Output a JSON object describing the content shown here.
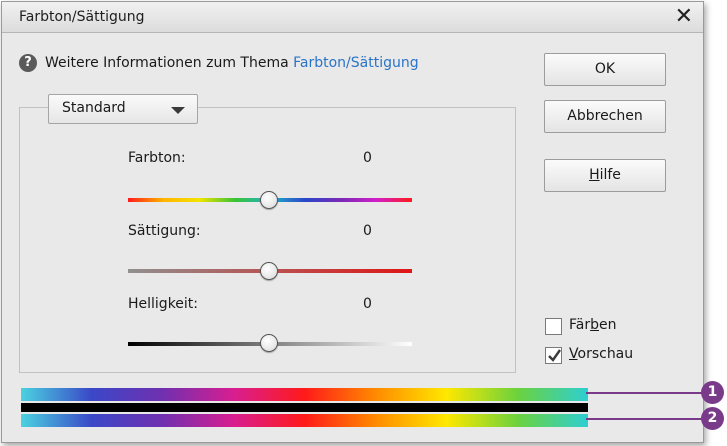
{
  "window": {
    "title": "Farbton/Sättigung"
  },
  "help": {
    "prefix": "Weitere Informationen zum Thema ",
    "link": "Farbton/Sättigung"
  },
  "preset": {
    "selected": "Standard"
  },
  "sliders": [
    {
      "label": "Farbton:",
      "value": "0"
    },
    {
      "label": "Sättigung:",
      "value": "0"
    },
    {
      "label": "Helligkeit:",
      "value": "0"
    }
  ],
  "buttons": {
    "ok": "OK",
    "cancel": "Abbrechen",
    "help_pre": "",
    "help_mnemonic": "H",
    "help_post": "ilfe"
  },
  "checkboxes": {
    "colorize": {
      "pre": "Fär",
      "mnemonic": "b",
      "post": "en",
      "checked": false
    },
    "preview": {
      "pre": "",
      "mnemonic": "V",
      "post": "orschau",
      "checked": true
    }
  },
  "callouts": [
    "1",
    "2"
  ],
  "colors": {
    "link": "#2a73c8",
    "callout": "#7a3a8a"
  }
}
